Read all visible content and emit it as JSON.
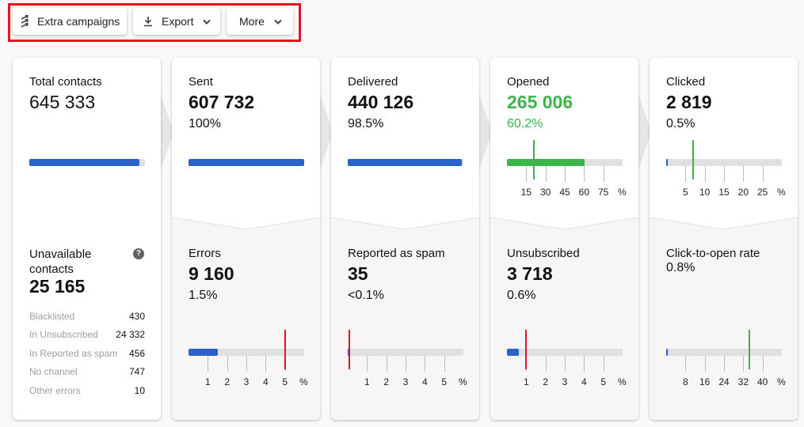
{
  "toolbar": {
    "extra_campaigns": {
      "label": "Extra campaigns",
      "icon": "arrows-icon"
    },
    "export": {
      "label": "Export",
      "icon": "download-icon"
    },
    "more": {
      "label": "More"
    }
  },
  "colors": {
    "blue": "#2a62cc",
    "green": "#3cb54a",
    "red": "#e8141c",
    "track": "#e0e0e0"
  },
  "cards": [
    {
      "id": "total",
      "top": {
        "title": "Total contacts",
        "value": "645 333",
        "bar_fraction": 0.95
      },
      "bottom": {
        "title": "Unavailable contacts",
        "value": "25 165",
        "breakdown": [
          {
            "label": "Blacklisted",
            "value": "430"
          },
          {
            "label": "In Unsubscribed",
            "value": "24 332"
          },
          {
            "label": "In Reported as spam",
            "value": "456"
          },
          {
            "label": "No channel",
            "value": "747"
          },
          {
            "label": "Other errors",
            "value": "10"
          }
        ]
      }
    },
    {
      "id": "sent",
      "top": {
        "title": "Sent",
        "value": "607 732",
        "percent": "100%",
        "bar_fraction": 1.0
      },
      "bottom": {
        "title": "Errors",
        "value": "9 160",
        "percent": "1.5%",
        "scale": {
          "max": 6,
          "ticks": [
            "1",
            "2",
            "3",
            "4",
            "5"
          ],
          "unit": "%",
          "value": 1.5,
          "threshold": 5.0,
          "threshold_color": "red"
        }
      }
    },
    {
      "id": "delivered",
      "top": {
        "title": "Delivered",
        "value": "440 126",
        "percent": "98.5%",
        "bar_fraction": 0.985
      },
      "bottom": {
        "title": "Reported as spam",
        "value": "35",
        "percent": "<0.1%",
        "scale": {
          "max": 6,
          "ticks": [
            "1",
            "2",
            "3",
            "4",
            "5"
          ],
          "unit": "%",
          "value": 0.02,
          "threshold": 0.1,
          "threshold_color": "red"
        }
      }
    },
    {
      "id": "opened",
      "top": {
        "title": "Opened",
        "value": "265 006",
        "percent": "60.2%",
        "highlight": "green",
        "scale": {
          "max": 90,
          "ticks": [
            "15",
            "30",
            "45",
            "60",
            "75"
          ],
          "unit": "%",
          "value": 60.2,
          "threshold": 21,
          "threshold_color": "green",
          "fill_color": "green"
        }
      },
      "bottom": {
        "title": "Unsubscribed",
        "value": "3 718",
        "percent": "0.6%",
        "scale": {
          "max": 6,
          "ticks": [
            "1",
            "2",
            "3",
            "4",
            "5"
          ],
          "unit": "%",
          "value": 0.6,
          "threshold": 1.0,
          "threshold_color": "red"
        }
      }
    },
    {
      "id": "clicked",
      "top": {
        "title": "Clicked",
        "value": "2 819",
        "percent": "0.5%",
        "scale": {
          "max": 30,
          "ticks": [
            "5",
            "10",
            "15",
            "20",
            "25"
          ],
          "unit": "%",
          "value": 0.5,
          "threshold": 6.9,
          "threshold_color": "green"
        }
      },
      "bottom": {
        "title": "Click-to-open rate",
        "value": "0.8%",
        "scale": {
          "max": 48,
          "ticks": [
            "8",
            "16",
            "24",
            "32",
            "40"
          ],
          "unit": "%",
          "value": 0.8,
          "threshold": 34.5,
          "threshold_color": "green"
        }
      }
    }
  ]
}
